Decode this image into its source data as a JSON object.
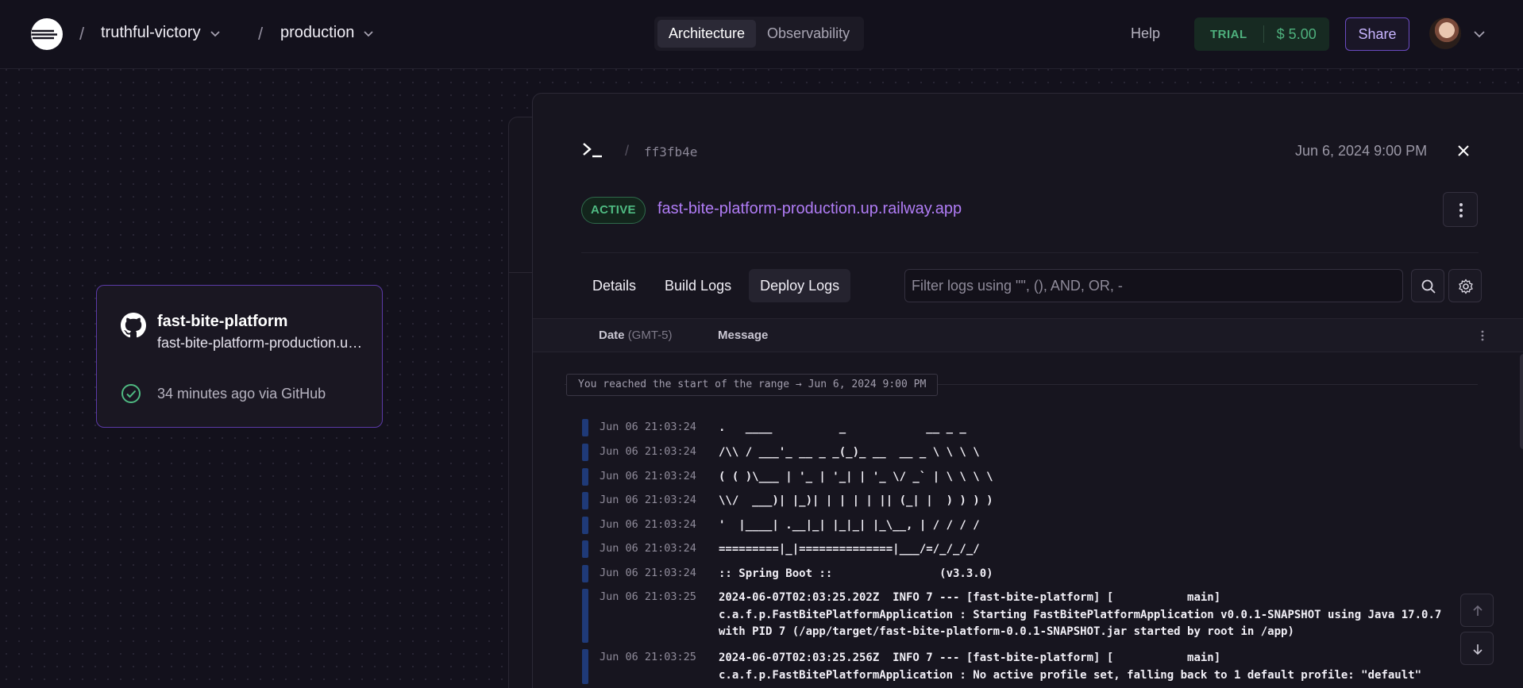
{
  "topbar": {
    "project": "truthful-victory",
    "environment": "production",
    "separator": "/",
    "tabs": [
      {
        "label": "Architecture",
        "active": true
      },
      {
        "label": "Observability",
        "active": false
      }
    ],
    "help": "Help",
    "trial_label": "TRIAL",
    "trial_amount": "$ 5.00",
    "share": "Share"
  },
  "service_card": {
    "name": "fast-bite-platform",
    "subtitle": "fast-bite-platform-production.up.railway.app",
    "status": "34 minutes ago via GitHub"
  },
  "panel": {
    "hash_separator": "/",
    "commit_hash": "ff3fb4e",
    "date": "Jun 6, 2024 9:00 PM",
    "status_badge": "ACTIVE",
    "domain": "fast-bite-platform-production.up.railway.app",
    "tabs": [
      {
        "label": "Details",
        "active": false
      },
      {
        "label": "Build Logs",
        "active": false
      },
      {
        "label": "Deploy Logs",
        "active": true
      }
    ],
    "filter_placeholder": "Filter logs using \"\", (), AND, OR, -",
    "columns": {
      "date": "Date",
      "date_tz": "(GMT-5)",
      "message": "Message"
    },
    "range_note": "You reached the start of the range → Jun 6, 2024 9:00 PM",
    "logs": [
      {
        "date": "Jun 06 21:03:24",
        "message": ".   ____          _            __ _ _"
      },
      {
        "date": "Jun 06 21:03:24",
        "message": "/\\\\ / ___'_ __ _ _(_)_ __  __ _ \\ \\ \\ \\"
      },
      {
        "date": "Jun 06 21:03:24",
        "message": "( ( )\\___ | '_ | '_| | '_ \\/ _` | \\ \\ \\ \\"
      },
      {
        "date": "Jun 06 21:03:24",
        "message": "\\\\/  ___)| |_)| | | | | || (_| |  ) ) ) )"
      },
      {
        "date": "Jun 06 21:03:24",
        "message": "'  |____| .__|_| |_|_| |_\\__, | / / / /"
      },
      {
        "date": "Jun 06 21:03:24",
        "message": "=========|_|==============|___/=/_/_/_/"
      },
      {
        "date": "Jun 06 21:03:24",
        "message": ":: Spring Boot ::                (v3.3.0)"
      },
      {
        "date": "Jun 06 21:03:25",
        "message": "2024-06-07T02:03:25.202Z  INFO 7 --- [fast-bite-platform] [           main] c.a.f.p.FastBitePlatformApplication : Starting FastBitePlatformApplication v0.0.1-SNAPSHOT using Java 17.0.7 with PID 7 (/app/target/fast-bite-platform-0.0.1-SNAPSHOT.jar started by root in /app)"
      },
      {
        "date": "Jun 06 21:03:25",
        "message": "2024-06-07T02:03:25.256Z  INFO 7 --- [fast-bite-platform] [           main] c.a.f.p.FastBitePlatformApplication : No active profile set, falling back to 1 default profile: \"default\""
      }
    ]
  },
  "icons": {
    "logo": "railway-logo-icon",
    "github": "github-icon",
    "check": "check-circle-icon",
    "terminal": "terminal-icon",
    "close": "close-icon",
    "more": "more-vertical-icon",
    "search": "search-icon",
    "settings": "gear-icon",
    "scroll_up": "arrow-up-icon",
    "scroll_down": "arrow-down-icon"
  },
  "colors": {
    "accent_purple": "#b07cf5",
    "active_green": "#4fba82",
    "log_bar": "#1f3a78",
    "background": "#13111c"
  }
}
